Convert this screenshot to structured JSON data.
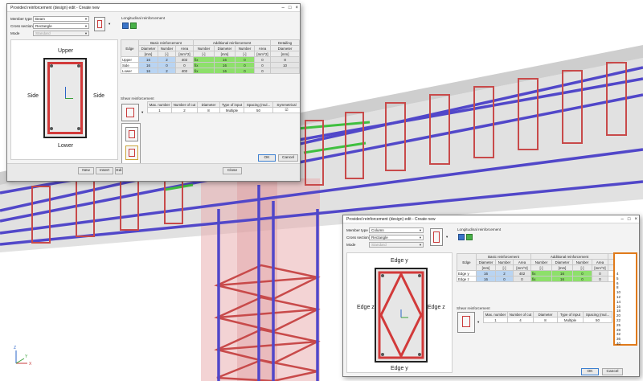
{
  "dialog1": {
    "title": "Provided reinforcement (design) edit - Create new",
    "member_type_label": "Member type",
    "member_type": "Beam",
    "cross_section_label": "Cross section",
    "cross_section": "Rectangle",
    "mode_label": "Mode",
    "mode": "Standard",
    "edge_upper": "Upper",
    "edge_lower": "Lower",
    "edge_side_left": "Side",
    "edge_side_right": "Side",
    "long_label": "Longitudinal reinforcement",
    "headers": {
      "edge": "Edge",
      "basic": "Basic reinforcement",
      "additional": "Additional reinforcement",
      "detailing": "Detailing",
      "diameter": "Diameter",
      "number": "Number",
      "area": "Area",
      "unit_mm": "[mm]",
      "unit_dash": "[-]",
      "unit_mm2": "[mm^2]"
    },
    "rows": [
      {
        "edge": "Upper",
        "d": "16",
        "n": "2",
        "a": "402",
        "an": "fix",
        "ad": "16",
        "ann": "0",
        "aa": "0",
        "det": "8"
      },
      {
        "edge": "Side",
        "d": "16",
        "n": "0",
        "a": "0",
        "an": "fix",
        "ad": "16",
        "ann": "0",
        "aa": "0",
        "det": "10"
      },
      {
        "edge": "Lower",
        "d": "16",
        "n": "2",
        "a": "402",
        "an": "fix",
        "ad": "16",
        "ann": "0",
        "aa": "0",
        "det": ""
      }
    ],
    "shear_label": "Shear reinforcement",
    "shear_headers": {
      "max_number": "Max. number",
      "number_of_cut": "Number of cut",
      "diameter": "Diameter",
      "type_of_input": "Type of input",
      "spacing": "Spacing (mul...",
      "symmetrical": "Symmetrical"
    },
    "shear_row": {
      "max": "1",
      "cut": "2",
      "dia": "8",
      "type": "Multiple",
      "spacing": "50",
      "sym": "☑"
    },
    "ok": "OK",
    "cancel": "Cancel",
    "new": "New",
    "insert": "Insert",
    "edit": "Edi",
    "close": "Close"
  },
  "dialog2": {
    "title": "Provided reinforcement (design) edit - Create new",
    "member_type_label": "Member type",
    "member_type": "Column",
    "cross_section_label": "Cross section",
    "cross_section": "Rectangle",
    "mode_label": "Mode",
    "mode": "Standard",
    "edge_y_top": "Edge y",
    "edge_y_bottom": "Edge y",
    "edge_z_left": "Edge z",
    "edge_z_right": "Edge z",
    "long_label": "Longitudinal reinforcement",
    "headers": {
      "edge": "Edge",
      "basic": "Basic reinforcement",
      "additional": "Additional reinforcement",
      "detailing": "Detailing",
      "diameter": "Diameter",
      "number": "Number",
      "area": "Area",
      "unit_mm": "[mm]",
      "unit_dash": "[-]",
      "unit_mm2": "[mm^2]"
    },
    "rows": [
      {
        "edge": "Edge y",
        "d": "16",
        "n": "2",
        "a": "402",
        "an": "fix",
        "ad": "16",
        "ann": "0",
        "aa": "0",
        "det": "10"
      },
      {
        "edge": "Edge z",
        "d": "16",
        "n": "0",
        "a": "0",
        "an": "fix",
        "ad": "16",
        "ann": "0",
        "aa": "0",
        "det": ""
      }
    ],
    "detailing_options": [
      "4",
      "5",
      "6",
      "8",
      "10",
      "12",
      "14",
      "16",
      "18",
      "20",
      "22",
      "25",
      "28",
      "32",
      "36",
      "40"
    ],
    "shear_label": "Shear reinforcement",
    "shear_headers": {
      "max_number": "Max. number",
      "number_of_cut": "Number of cut",
      "diameter": "Diameter",
      "type_of_input": "Type of input",
      "spacing": "Spacing (mul..."
    },
    "shear_row": {
      "max": "1",
      "cut": "4",
      "dia": "8",
      "type": "Multiple",
      "spacing": "50"
    },
    "ok": "OK",
    "cancel": "Cancel"
  },
  "axes": {
    "z": "Z",
    "x": "X",
    "y": "Y"
  },
  "colors": {
    "bar_purple": "#5147c9",
    "stirrup_red": "#c84a4a",
    "bar_green": "#3fbf3f",
    "concrete_pink": "#e9aeb0",
    "highlight_orange": "#e07a1a"
  }
}
